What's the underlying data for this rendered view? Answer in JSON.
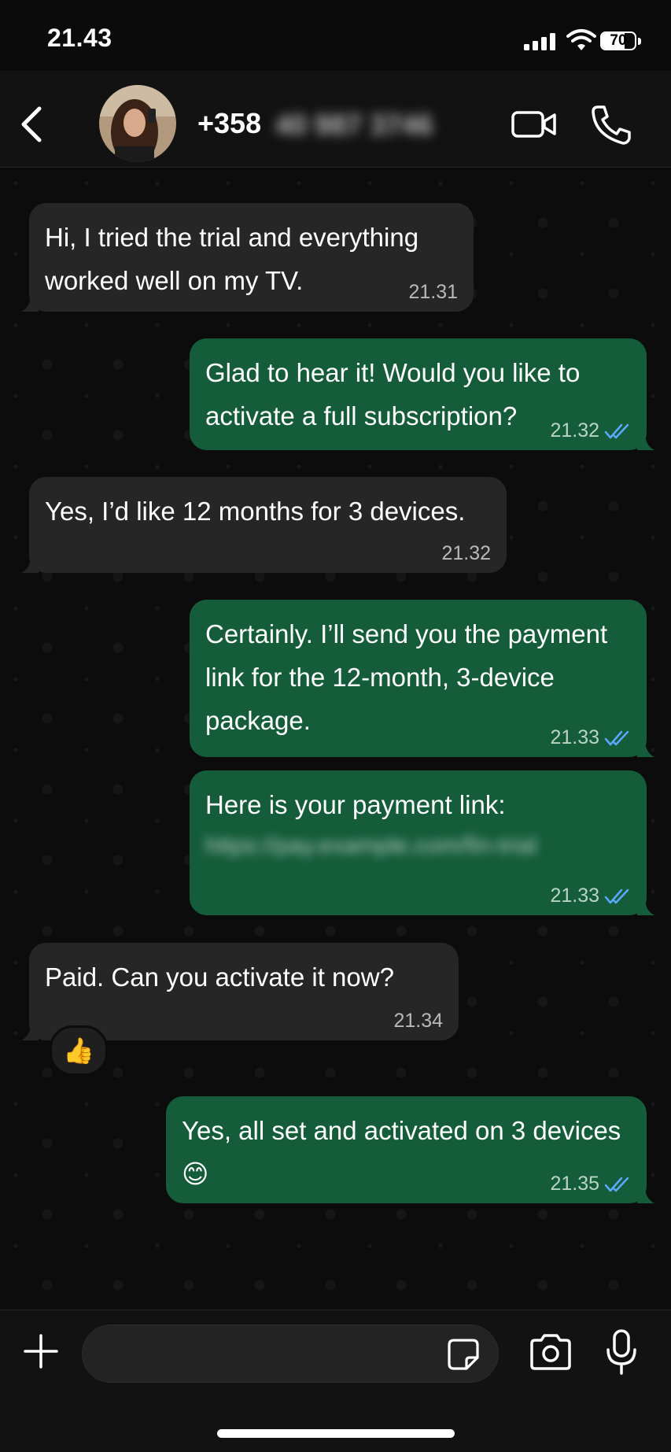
{
  "status_bar": {
    "time": "21.43",
    "battery": "70",
    "battery_level": 0.7
  },
  "header": {
    "contact_number": "+358",
    "contact_number_hidden": "40 987 3746",
    "back_icon": "chevron-left-icon",
    "video_icon": "video-camera-icon",
    "call_icon": "phone-icon"
  },
  "messages": [
    {
      "direction": "incoming",
      "text": "Hi, I tried the trial and everything\nworked well on my TV.",
      "time": "21.31"
    },
    {
      "direction": "outgoing",
      "text": "Glad to hear it! Would you like to\nactivate a full subscription?",
      "time": "21.32",
      "read": true
    },
    {
      "direction": "incoming",
      "text": "Yes, I’d like 12 months for 3 devices.",
      "time": "21.32"
    },
    {
      "direction": "outgoing",
      "text": "Certainly. I’ll send you the payment\nlink for the 12-month, 3-device\npackage.",
      "time": "21.33",
      "read": true
    },
    {
      "direction": "outgoing",
      "text": "Here is your payment link:",
      "link": "https://pay.example.com/fin-trial",
      "time": "21.33",
      "read": true
    },
    {
      "direction": "incoming",
      "text": "Paid. Can you activate it now?",
      "time": "21.34",
      "reaction": "👍"
    },
    {
      "direction": "outgoing",
      "text": "Yes, all set and activated on 3 devices 😊",
      "time": "21.35",
      "read": true
    }
  ],
  "composer": {
    "placeholder": "",
    "value": ""
  },
  "colors": {
    "incoming_bubble": "#262626",
    "outgoing_bubble": "#145c3a",
    "read_ticks": "#5aa9ff"
  }
}
